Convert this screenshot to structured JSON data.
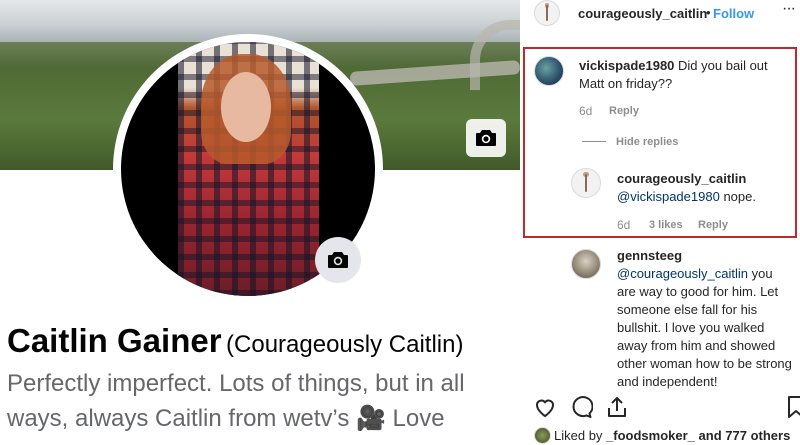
{
  "facebook": {
    "name": "Caitlin Gainer",
    "alt_name": "(Courageously Caitlin)",
    "bio": "Perfectly imperfect. Lots of things, but in all ways, always Caitlin from wetv’s 🎥 Love"
  },
  "instagram": {
    "header": {
      "username": "courageously_caitlin",
      "separator": "•",
      "follow": "Follow",
      "more": "···"
    },
    "comments": [
      {
        "username": "vickispade1980",
        "text": "Did you bail out Matt on friday??",
        "time": "6d",
        "reply": "Reply"
      }
    ],
    "hide_replies": "Hide replies",
    "reply_comment": {
      "username": "courageously_caitlin",
      "mention": "@vickispade1980",
      "text": "nope.",
      "time": "6d",
      "likes": "3 likes",
      "reply": "Reply"
    },
    "third_comment": {
      "username": "gennsteeg",
      "mention": "@courageously_caitlin",
      "text": "you are way to good for him. Let someone else fall for his bullshit. I love you walked away from him and showed other woman how to be strong and independent!"
    },
    "liked_by": {
      "prefix": "Liked by",
      "user": "_foodsmoker_",
      "suffix": "and 777 others"
    }
  },
  "colors": {
    "highlight": "#c0282d",
    "follow_blue": "#3897f0",
    "mention_blue": "#003569"
  }
}
